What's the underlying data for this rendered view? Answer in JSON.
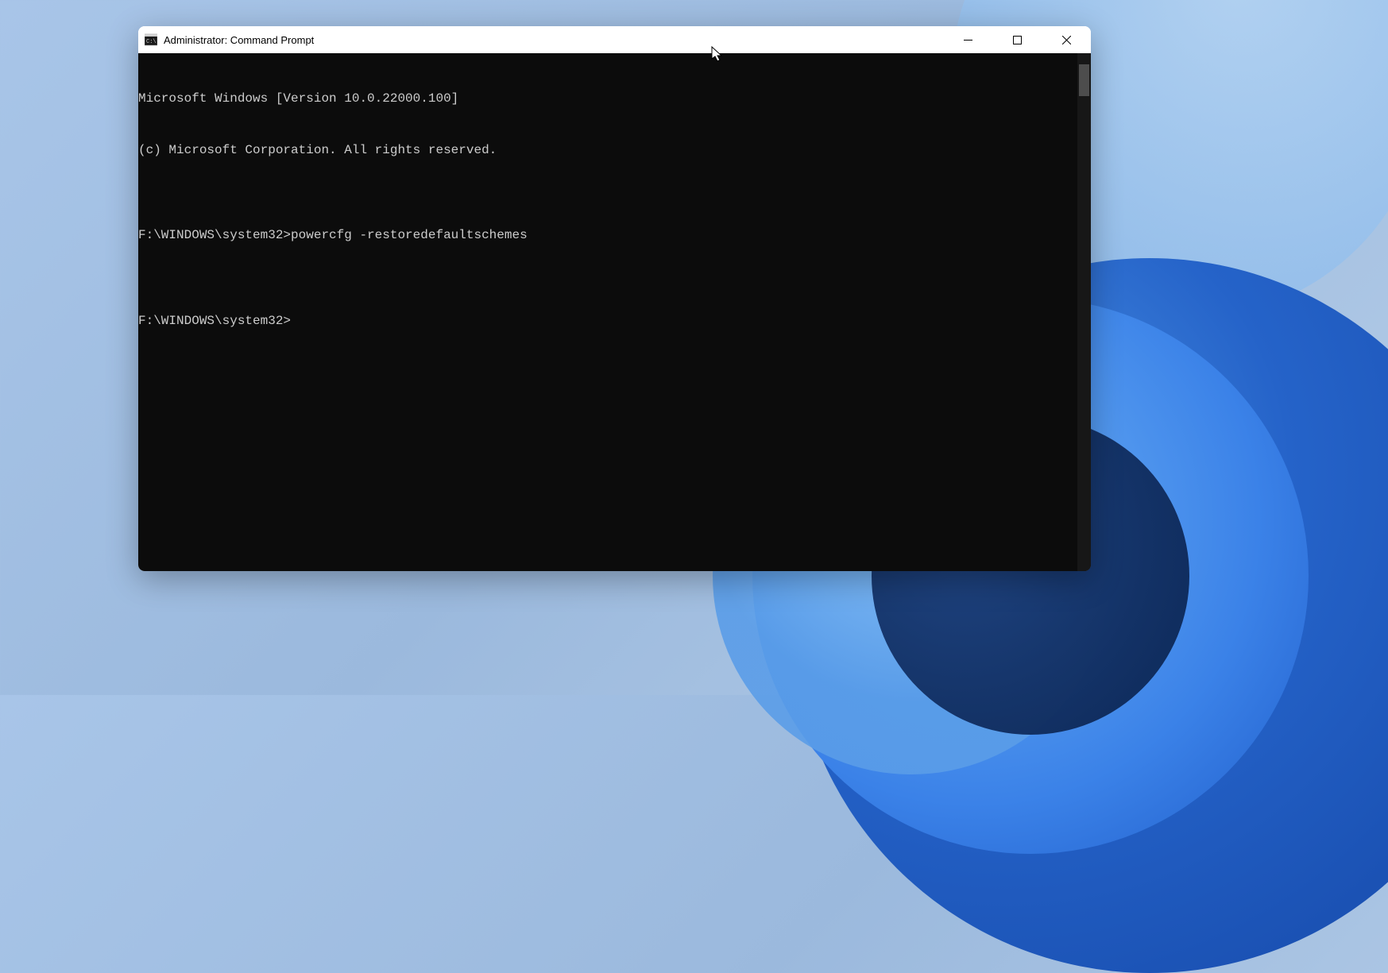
{
  "window": {
    "title": "Administrator: Command Prompt",
    "icon": "cmd-icon"
  },
  "controls": {
    "minimize": "minimize",
    "maximize": "maximize",
    "close": "close"
  },
  "console": {
    "lines": [
      "Microsoft Windows [Version 10.0.22000.100]",
      "(c) Microsoft Corporation. All rights reserved.",
      "",
      "F:\\WINDOWS\\system32>powercfg -restoredefaultschemes",
      "",
      "F:\\WINDOWS\\system32>"
    ]
  }
}
